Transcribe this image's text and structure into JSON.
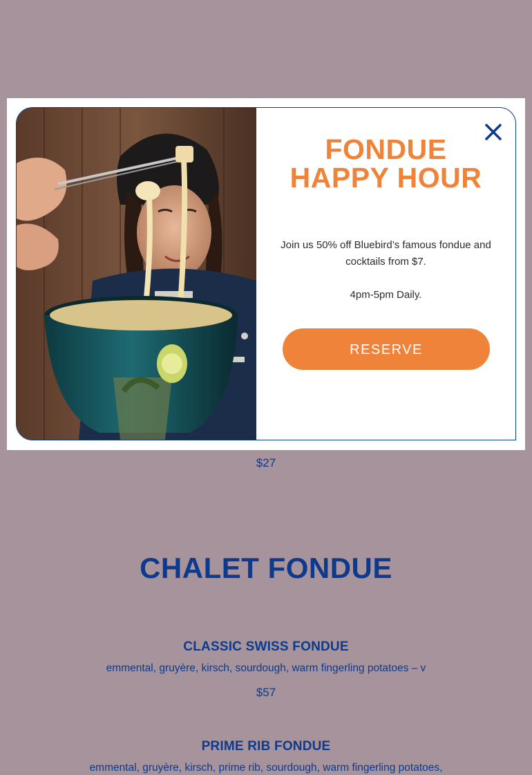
{
  "modal": {
    "headline_line1": "FONDUE",
    "headline_line2": "HAPPY HOUR",
    "body": "Join us 50% off Bluebird’s famous fondue and cocktails from $7.",
    "hours": "4pm-5pm Daily.",
    "reserve_label": "RESERVE",
    "close_icon": "close-icon",
    "colors": {
      "accent": "#ef833a",
      "brand_blue": "#0d3a8c"
    }
  },
  "page": {
    "previous_item_price": "$27",
    "section_title": "CHALET FONDUE",
    "items": [
      {
        "name": "CLASSIC SWISS FONDUE",
        "description": "emmental, gruyère, kirsch, sourdough, warm fingerling potatoes – v",
        "price": "$57"
      },
      {
        "name": "PRIME RIB FONDUE",
        "description": "emmental, gruyère, kirsch, prime rib, sourdough, warm fingerling potatoes,"
      }
    ],
    "overlay_color": "#a6939b"
  }
}
